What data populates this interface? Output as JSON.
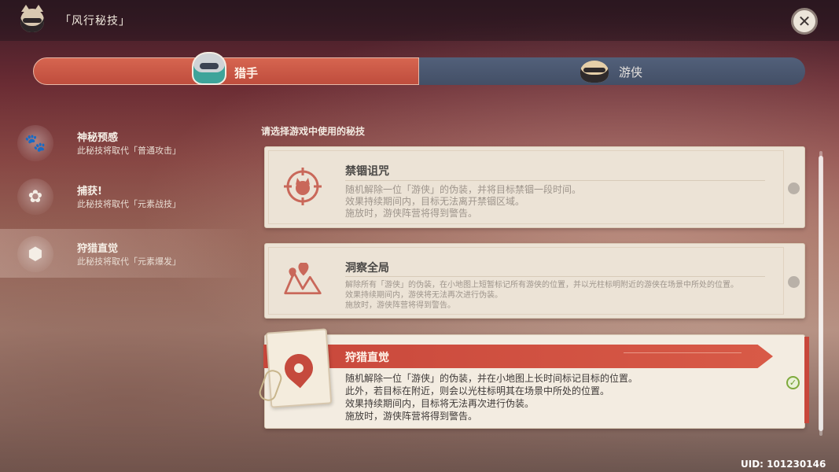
{
  "header": {
    "title": "「风行秘技」"
  },
  "teams": {
    "hunter_label": "猎手",
    "ranger_label": "游侠",
    "active": "hunter"
  },
  "skills": [
    {
      "name": "神秘预感",
      "desc": "此秘技将取代「普通攻击」",
      "icon": "paw-print-icon",
      "glyph": "🐾"
    },
    {
      "name": "捕获!",
      "desc": "此秘技将取代「元素战技」",
      "icon": "paw-pad-icon",
      "glyph": "✿"
    },
    {
      "name": "狩猎直觉",
      "desc": "此秘技将取代「元素爆发」",
      "icon": "location-pin-icon",
      "glyph": "⬢"
    }
  ],
  "selection": {
    "prompt": "请选择游戏中使用的秘技",
    "options": [
      {
        "title": "禁锢诅咒",
        "icon": "crosshair-cat-icon",
        "lines": [
          "随机解除一位「游侠」的伪装，并将目标禁锢一段时间。",
          "效果持续期间内，目标无法离开禁锢区域。",
          "施放时，游侠阵营将得到警告。"
        ]
      },
      {
        "title": "洞察全局",
        "icon": "map-pins-icon",
        "lines": [
          "解除所有「游侠」的伪装，在小地图上短暂标记所有游侠的位置，并以光柱标明附近的游侠在场景中所处的位置。",
          "效果持续期间内，游侠将无法再次进行伪装。",
          "施放时，游侠阵营将得到警告。"
        ]
      },
      {
        "title": "狩猎直觉",
        "icon": "location-pin-icon",
        "selected": true,
        "lines": [
          "随机解除一位「游侠」的伪装，并在小地图上长时间标记目标的位置。",
          "此外，若目标在附近，则会以光柱标明其在场景中所处的位置。",
          "效果持续期间内，目标将无法再次进行伪装。",
          "施放时，游侠阵营将得到警告。"
        ]
      }
    ]
  },
  "footer": {
    "uid": "UID: 101230146"
  },
  "colors": {
    "accent_red": "#c8473b",
    "ranger_blue": "#4b5770",
    "card_bg": "#ece3d6",
    "check_green": "#7faa3d"
  }
}
